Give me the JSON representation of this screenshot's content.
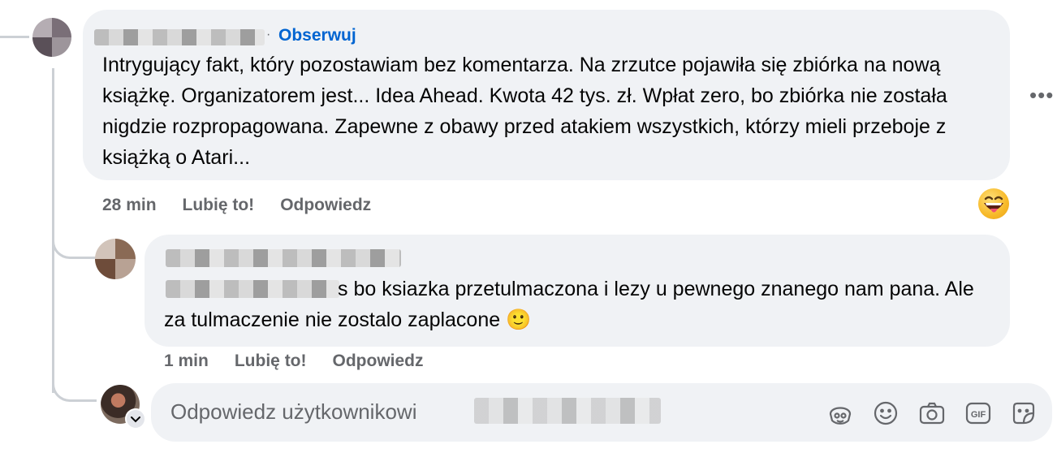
{
  "comment": {
    "follow_label": "Obserwuj",
    "separator": "·",
    "text": "Intrygujący fakt, który pozostawiam bez komentarza. Na zrzutce pojawiła się zbiórka na nową książkę. Organizatorem jest... Idea Ahead. Kwota 42 tys. zł. Wpłat zero, bo zbiórka nie została nigdzie rozpropagowana. Zapewne z obawy przed atakiem wszystkich, którzy mieli przeboje z książką o Atari...",
    "time": "28 min",
    "like_label": "Lubię to!",
    "reply_label": "Odpowiedz",
    "reaction_icon": "grinning-face-with-tongue-icon",
    "more_icon": "more-options-icon"
  },
  "reply": {
    "text": "s bo ksiazka przetulmaczona i lezy u pewnego znanego nam pana. Ale za tulmaczenie nie zostalo zaplacone 🙂",
    "time": "1 min",
    "like_label": "Lubię to!",
    "reply_label": "Odpowiedz"
  },
  "composer": {
    "placeholder": "Odpowiedz użytkownikowi",
    "tools": [
      "avatar-sticker-icon",
      "emoji-icon",
      "camera-icon",
      "gif-icon",
      "sticker-icon"
    ],
    "gif_label": "GIF"
  },
  "colors": {
    "bubble": "#f0f2f5",
    "secondary_text": "#65676b",
    "link": "#0064d1",
    "thread_line": "#ccd0d5"
  }
}
